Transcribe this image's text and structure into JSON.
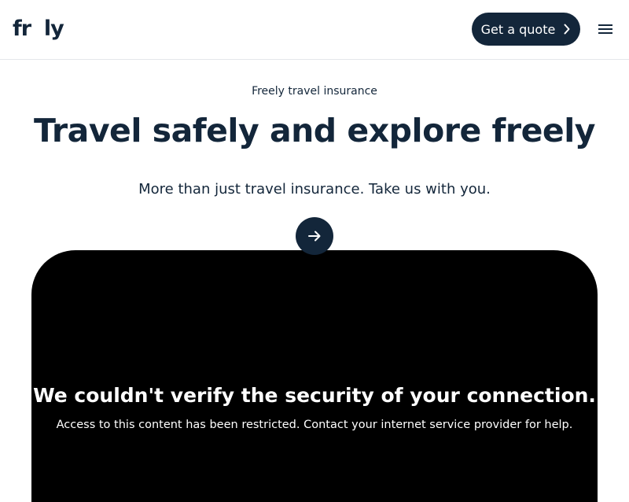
{
  "header": {
    "logo_text": "fr  ly",
    "quote_button_label": "Get a quote",
    "menu_icon": "hamburger-menu-icon",
    "quote_icon": "chevron-right-icon"
  },
  "hero": {
    "eyebrow": "Freely travel insurance",
    "headline": "Travel safely and explore freely",
    "subheadline": "More than just travel insurance. Take us with you.",
    "arrow_icon": "arrow-right-icon"
  },
  "blocked": {
    "title": "We couldn't verify the security of your connection.",
    "message": "Access to this content has been restricted. Contact your internet service provider for help."
  },
  "colors": {
    "navy": "#13263a",
    "panel": "#000000",
    "background": "#ffffff"
  }
}
